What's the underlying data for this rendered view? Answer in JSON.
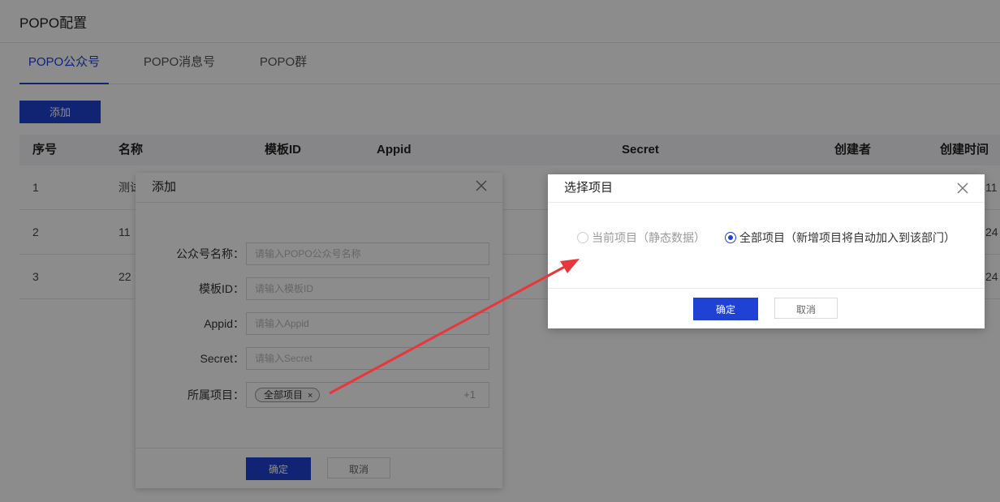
{
  "page": {
    "title": "POPO配置",
    "tabs": [
      {
        "label": "POPO公众号",
        "active": true
      },
      {
        "label": "POPO消息号",
        "active": false
      },
      {
        "label": "POPO群",
        "active": false
      }
    ],
    "add_button": "添加"
  },
  "table": {
    "columns": [
      "序号",
      "名称",
      "模板ID",
      "Appid",
      "Secret",
      "创建者",
      "创建时间"
    ],
    "rows": [
      {
        "index": "1",
        "name": "测试",
        "time_tail": "11"
      },
      {
        "index": "2",
        "name": "11",
        "time_tail": "24"
      },
      {
        "index": "3",
        "name": "22",
        "time_tail": "24"
      }
    ]
  },
  "add_dialog": {
    "title": "添加",
    "fields": [
      {
        "label": "公众号名称：",
        "placeholder": "请输入POPO公众号名称"
      },
      {
        "label": "模板ID：",
        "placeholder": "请输入模板ID"
      },
      {
        "label": "Appid：",
        "placeholder": "请输入Appid"
      },
      {
        "label": "Secret：",
        "placeholder": "请输入Secret"
      }
    ],
    "project_field": {
      "label": "所属项目：",
      "tag": "全部项目",
      "tag_close": "×",
      "more": "+1"
    },
    "confirm": "确定",
    "cancel": "取消"
  },
  "select_dialog": {
    "title": "选择项目",
    "options": [
      {
        "label": "当前项目（静态数据）",
        "checked": false,
        "disabled": true
      },
      {
        "label": "全部项目（新增项目将自动加入到该部门）",
        "checked": true,
        "disabled": false
      }
    ],
    "confirm": "确定",
    "cancel": "取消"
  },
  "colors": {
    "primary": "#1f42d4",
    "annotation_arrow": "#e8373c",
    "overlay": "rgba(0,0,0,0.45)"
  }
}
